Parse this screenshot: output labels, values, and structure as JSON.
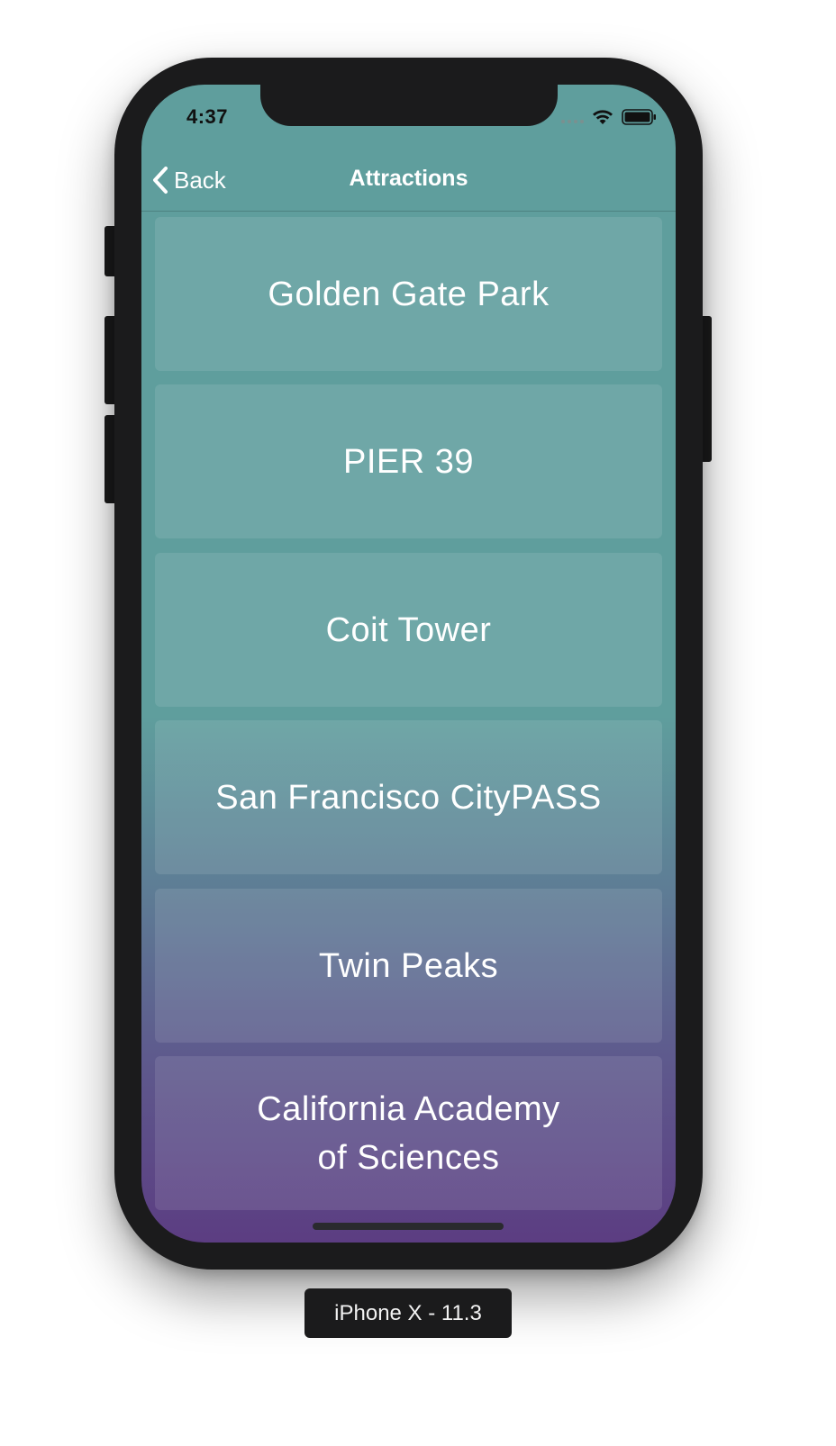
{
  "device": {
    "label": "iPhone X - 11.3"
  },
  "status_bar": {
    "time": "4:37"
  },
  "navbar": {
    "back_label": "Back",
    "title": "Attractions"
  },
  "attractions": [
    "Golden Gate Park",
    "PIER 39",
    "Coit Tower",
    "San Francisco CityPASS",
    "Twin Peaks",
    "California Academy\nof Sciences"
  ],
  "colors": {
    "top_background": "#5f9e9d",
    "bottom_background": "#5c3d82",
    "text": "#ffffff"
  },
  "icons": [
    "chevron-left-icon",
    "signal-icon",
    "wifi-icon",
    "battery-icon"
  ]
}
